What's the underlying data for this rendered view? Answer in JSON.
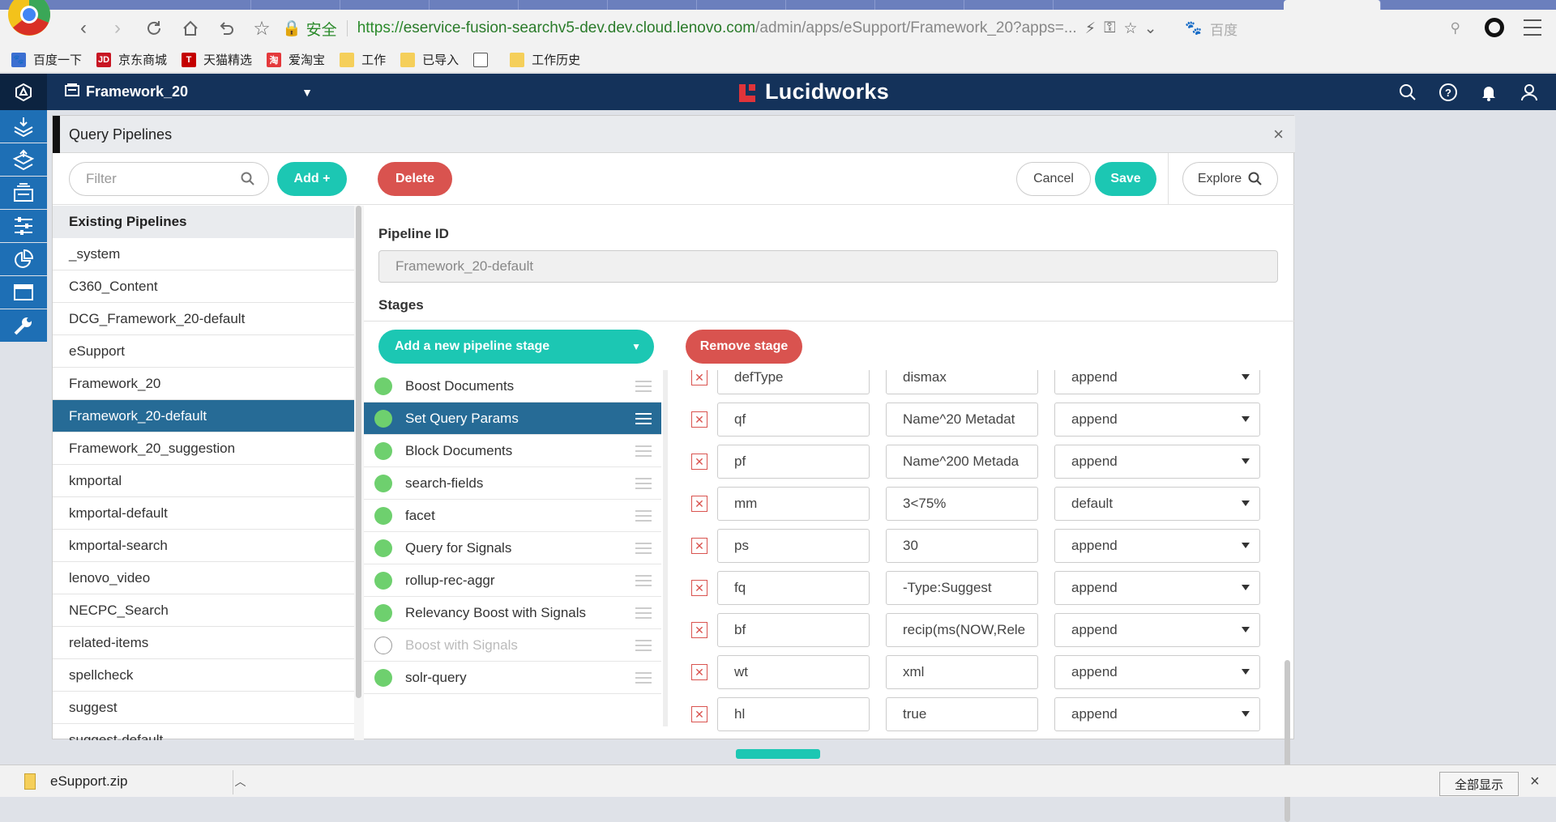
{
  "browser": {
    "secure_label": "安全",
    "url_proto": "https://",
    "url_host": "eservice-fusion-searchv5-dev.dev.cloud.lenovo.com",
    "url_path": "/admin/apps/eSupport/Framework_20?apps=...",
    "search_placeholder": "百度",
    "bookmarks": [
      "百度一下",
      "京东商城",
      "天猫精选",
      "爱淘宝",
      "工作",
      "已导入",
      "",
      "工作历史"
    ]
  },
  "app": {
    "name": "Framework_20",
    "brand": "Lucidworks"
  },
  "panel": {
    "title": "Query Pipelines",
    "close": "×",
    "filter_placeholder": "Filter",
    "add_label": "Add +",
    "delete_label": "Delete",
    "cancel_label": "Cancel",
    "save_label": "Save",
    "explore_label": "Explore"
  },
  "pipelines": {
    "heading": "Existing Pipelines",
    "items": [
      "_system",
      "C360_Content",
      "DCG_Framework_20-default",
      "eSupport",
      "Framework_20",
      "Framework_20-default",
      "Framework_20_suggestion",
      "kmportal",
      "kmportal-default",
      "kmportal-search",
      "lenovo_video",
      "NECPC_Search",
      "related-items",
      "spellcheck",
      "suggest",
      "suggest-default"
    ],
    "selected": "Framework_20-default"
  },
  "detail": {
    "pipeline_id_label": "Pipeline ID",
    "pipeline_id_value": "Framework_20-default",
    "stages_label": "Stages",
    "add_stage_label": "Add a new pipeline stage",
    "remove_stage_label": "Remove stage"
  },
  "stages": [
    {
      "name": "Boost Documents",
      "enabled": true
    },
    {
      "name": "Set Query Params",
      "enabled": true,
      "selected": true
    },
    {
      "name": "Block Documents",
      "enabled": true
    },
    {
      "name": "search-fields",
      "enabled": true
    },
    {
      "name": "facet",
      "enabled": true
    },
    {
      "name": "Query for Signals",
      "enabled": true
    },
    {
      "name": "rollup-rec-aggr",
      "enabled": true
    },
    {
      "name": "Relevancy Boost with Signals",
      "enabled": true
    },
    {
      "name": "Boost with Signals",
      "enabled": false
    },
    {
      "name": "solr-query",
      "enabled": true
    }
  ],
  "params": [
    {
      "key": "defType",
      "value": "dismax",
      "policy": "append"
    },
    {
      "key": "qf",
      "value": "Name^20 Metadat",
      "policy": "append"
    },
    {
      "key": "pf",
      "value": "Name^200 Metada",
      "policy": "append"
    },
    {
      "key": "mm",
      "value": "3<75%",
      "policy": "default"
    },
    {
      "key": "ps",
      "value": "30",
      "policy": "append"
    },
    {
      "key": "fq",
      "value": "-Type:Suggest",
      "policy": "append"
    },
    {
      "key": "bf",
      "value": "recip(ms(NOW,Rele",
      "policy": "append"
    },
    {
      "key": "wt",
      "value": "xml",
      "policy": "append"
    },
    {
      "key": "hl",
      "value": "true",
      "policy": "append"
    }
  ],
  "downloads": {
    "file": "eSupport.zip",
    "show_all": "全部显示",
    "close": "×"
  },
  "colors": {
    "header": "#14325a",
    "sidebar": "#1e6fb5",
    "accent_teal": "#1cc7b3",
    "danger": "#d9534f",
    "selected_row": "#266b96",
    "stage_enabled": "#6ed06e"
  }
}
